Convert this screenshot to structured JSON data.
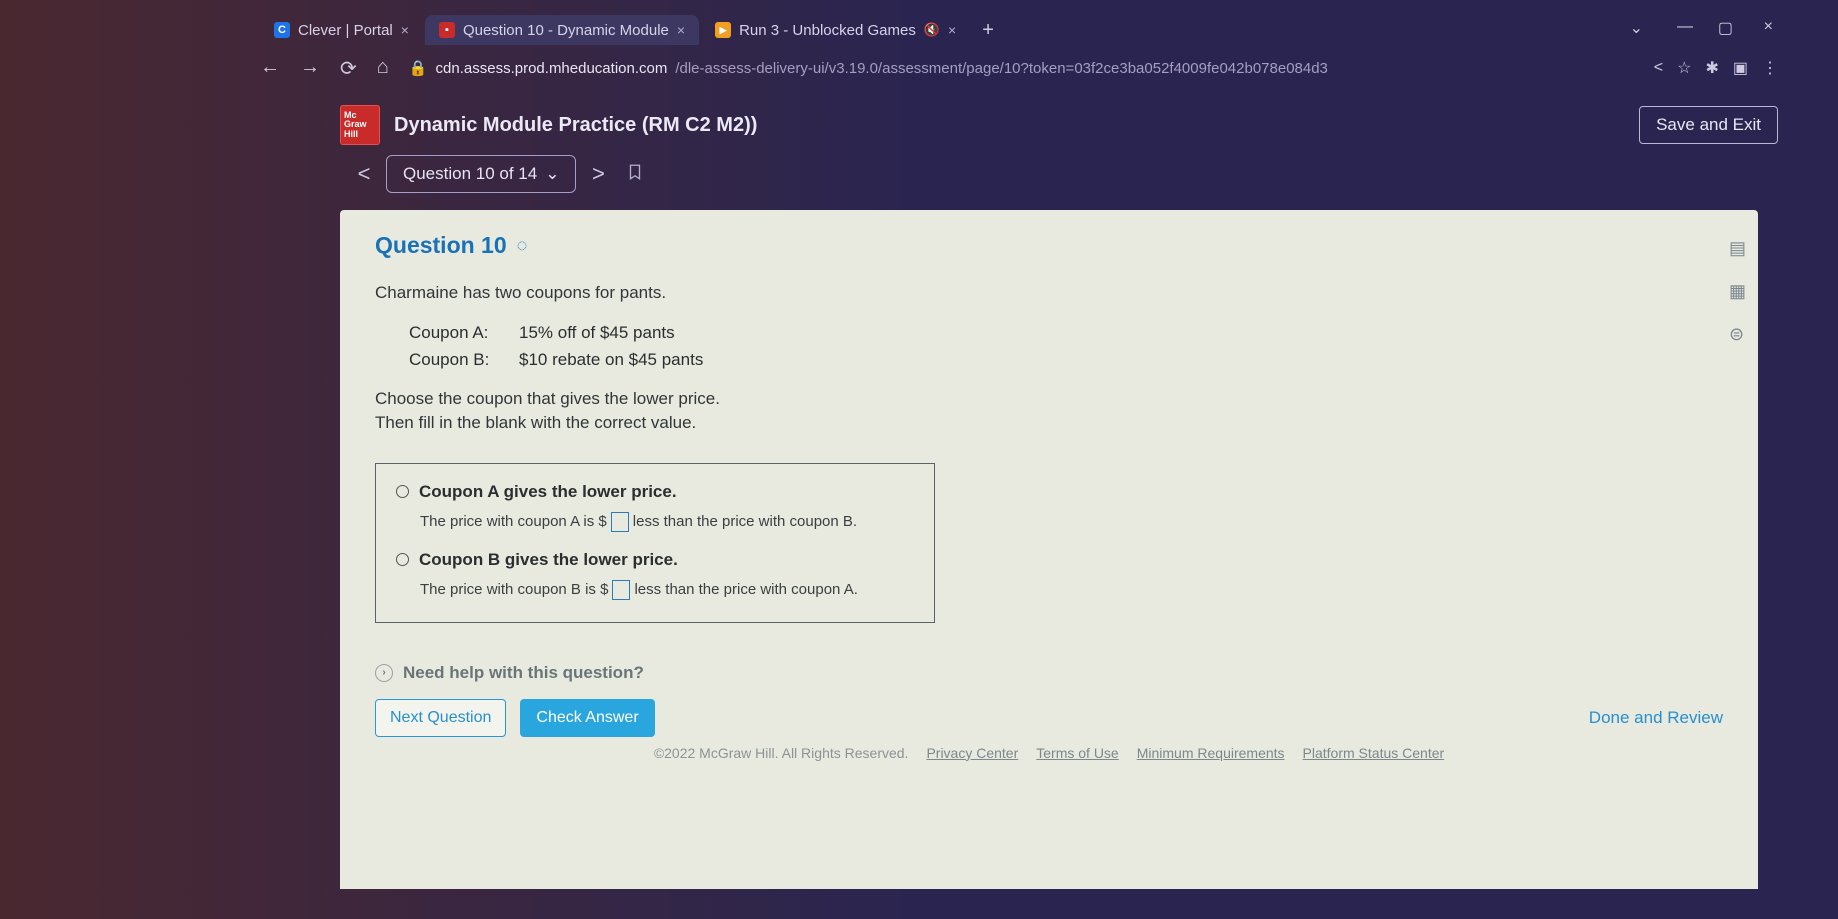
{
  "tabs": {
    "clever": "Clever | Portal",
    "mcgraw": "Question 10 - Dynamic Module",
    "run3": "Run 3 - Unblocked Games"
  },
  "url": {
    "domain": "cdn.assess.prod.mheducation.com",
    "path": "/dle-assess-delivery-ui/v3.19.0/assessment/page/10?token=03f2ce3ba052f4009fe042b078e084d3"
  },
  "app": {
    "logo_l1": "Mc",
    "logo_l2": "Graw",
    "logo_l3": "Hill",
    "title": "Dynamic Module Practice (RM C2 M2))",
    "save_exit": "Save and Exit",
    "q_of": "Question 10 of 14"
  },
  "question": {
    "heading": "Question 10",
    "intro": "Charmaine has two coupons for pants.",
    "couponA_label": "Coupon A:",
    "couponA_text": "15% off of $45 pants",
    "couponB_label": "Coupon B:",
    "couponB_text": "$10 rebate on $45 pants",
    "instruct1": "Choose the coupon that gives the lower price.",
    "instruct2": "Then fill in the blank with the correct value.",
    "optA": "Coupon A gives the lower price.",
    "optA_detail_pre": "The price with coupon A is $",
    "optA_detail_post": " less than the price with coupon B.",
    "optB": "Coupon B gives the lower price.",
    "optB_detail_pre": "The price with coupon B is $",
    "optB_detail_post": " less than the price with coupon A.",
    "help": "Need help with this question?",
    "next": "Next Question",
    "check": "Check Answer",
    "done": "Done and Review"
  },
  "footer": {
    "copyright": "©2022 McGraw Hill. All Rights Reserved.",
    "privacy": "Privacy Center",
    "terms": "Terms of Use",
    "minreq": "Minimum Requirements",
    "status": "Platform Status Center"
  }
}
